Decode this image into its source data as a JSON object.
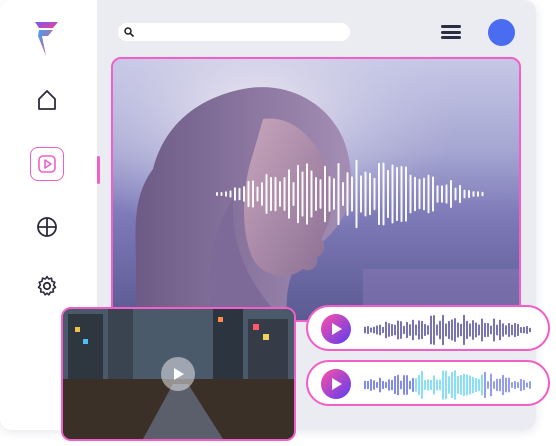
{
  "search": {
    "placeholder": ""
  },
  "sidebar": {
    "items": [
      {
        "id": "home",
        "icon": "home-icon"
      },
      {
        "id": "video",
        "icon": "play-square-icon",
        "active": true
      },
      {
        "id": "apps",
        "icon": "pie-chart-icon"
      },
      {
        "id": "settings",
        "icon": "gear-icon"
      }
    ]
  },
  "colors": {
    "accent": "#f060c8",
    "avatar": "#4a6cf0",
    "play_gradient_start": "#ff4fa6",
    "play_gradient_end": "#5b3df0",
    "waveform_primary": "#2f2a8a",
    "waveform_secondary": "#4aa4f0"
  },
  "audio_tracks": [
    {
      "id": "track-1",
      "waveform_style": "dark"
    },
    {
      "id": "track-2",
      "waveform_style": "colorful"
    }
  ]
}
